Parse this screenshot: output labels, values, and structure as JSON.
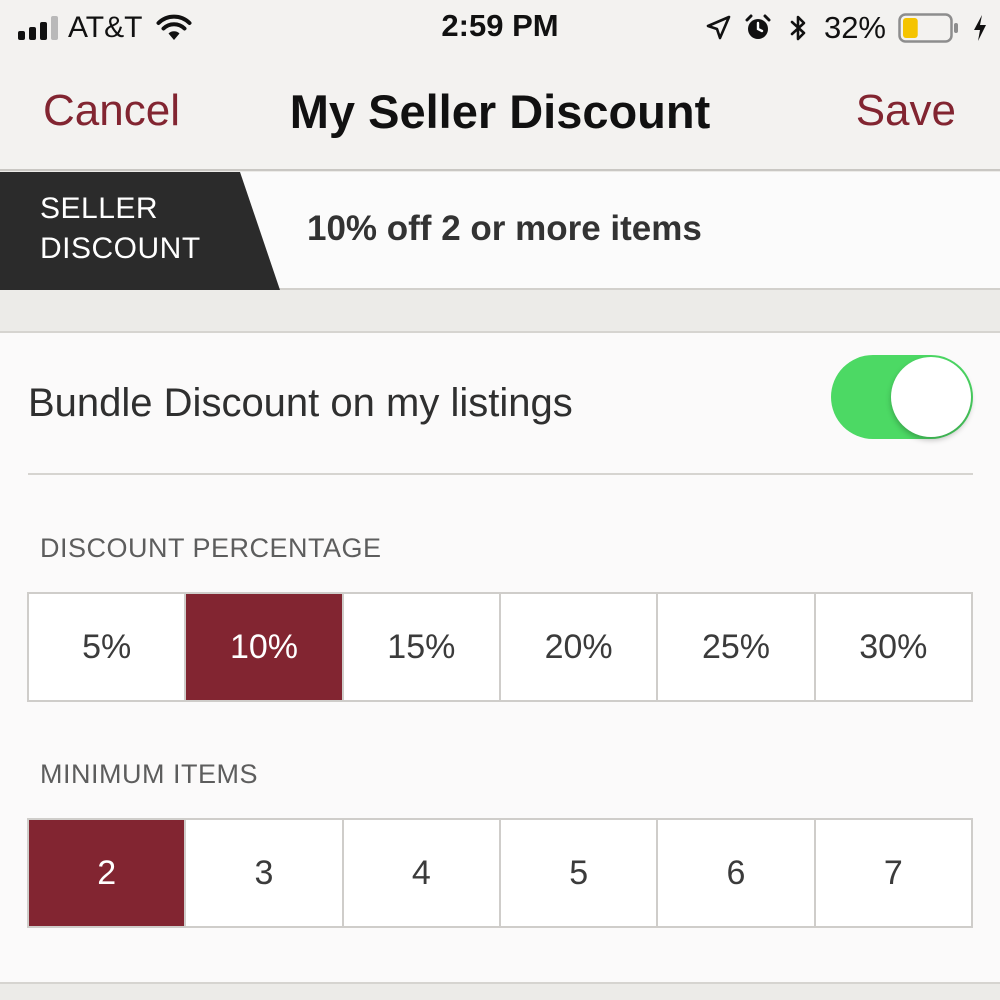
{
  "status_bar": {
    "carrier": "AT&T",
    "time": "2:59 PM",
    "battery_percent": "32%",
    "battery_level": 0.32,
    "battery_color": "#f5c400",
    "icons": [
      "signal-icon",
      "wifi-icon",
      "location-arrow-icon",
      "alarm-icon",
      "bluetooth-icon",
      "battery-icon",
      "charging-icon"
    ]
  },
  "nav": {
    "cancel_label": "Cancel",
    "title": "My Seller Discount",
    "save_label": "Save"
  },
  "banner": {
    "tag_line1": "SELLER",
    "tag_line2": "DISCOUNT",
    "summary": "10% off 2 or more items"
  },
  "bundle": {
    "toggle_label": "Bundle Discount on my listings",
    "toggle_on": true
  },
  "discount_percentage": {
    "label": "DISCOUNT PERCENTAGE",
    "options": [
      "5%",
      "10%",
      "15%",
      "20%",
      "25%",
      "30%"
    ],
    "selected": "10%"
  },
  "minimum_items": {
    "label": "MINIMUM ITEMS",
    "options": [
      "2",
      "3",
      "4",
      "5",
      "6",
      "7"
    ],
    "selected": "2"
  },
  "colors": {
    "accent": "#822531",
    "toggle_on": "#4cd964",
    "banner_tag": "#2b2b2b"
  }
}
